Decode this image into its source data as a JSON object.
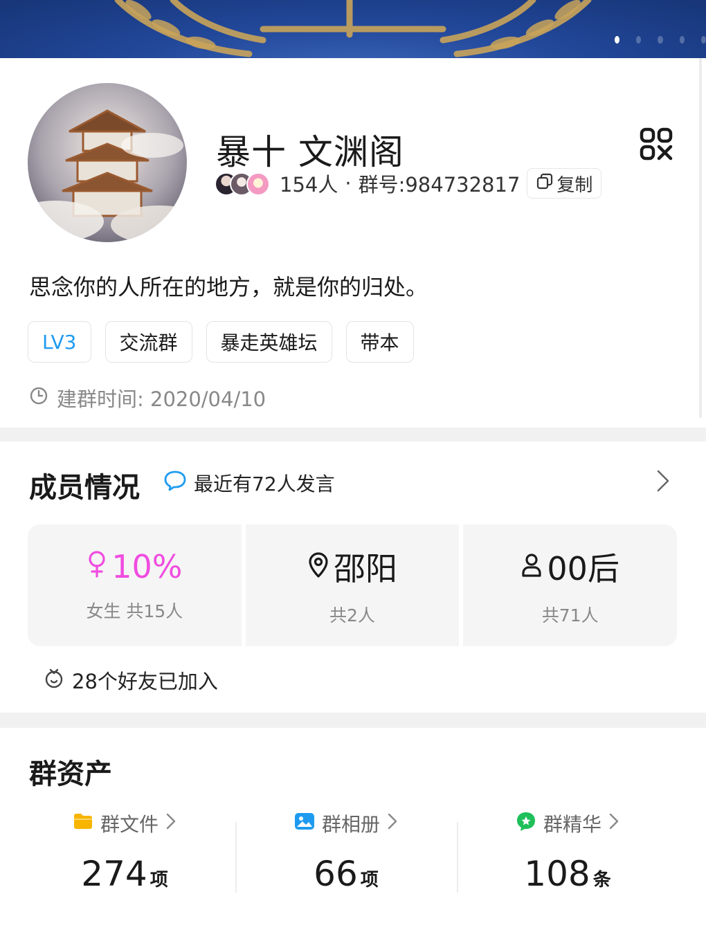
{
  "banner": {
    "slide_count": 5,
    "active_slide": 1,
    "image": "un-emblem-laurel"
  },
  "profile": {
    "group_name": "暴十 文渊阁",
    "member_count": "154人",
    "separator": "·",
    "group_id": "群号:984732817",
    "copy_label": "复制",
    "description": "思念你的人所在的地方，就是你的归处。",
    "tags": [
      "LV3",
      "交流群",
      "暴走英雄坛",
      "带本"
    ],
    "created_label": "建群时间: 2020/04/10",
    "icons": {
      "qr": "qr-code-icon",
      "copy": "copy-icon",
      "clock": "clock-icon"
    }
  },
  "members": {
    "title": "成员情况",
    "recent_text": "最近有72人发言",
    "stats": [
      {
        "main": "10%",
        "sub": "女生 共15人",
        "icon": "female-icon"
      },
      {
        "main": "邵阳",
        "sub": "共2人",
        "icon": "location-pin-icon"
      },
      {
        "main": "00后",
        "sub": "共71人",
        "icon": "person-icon"
      }
    ],
    "friends_text": "28个好友已加入"
  },
  "assets": {
    "title": "群资产",
    "items": [
      {
        "label": "群文件",
        "value": "274",
        "unit": "项",
        "icon": "folder-icon"
      },
      {
        "label": "群相册",
        "value": "66",
        "unit": "项",
        "icon": "photo-album-icon"
      },
      {
        "label": "群精华",
        "value": "108",
        "unit": "条",
        "icon": "essence-icon"
      }
    ]
  },
  "colors": {
    "accent_blue": "#1e9bf0",
    "female_pink": "#f04ce0",
    "folder_yellow": "#f7b500",
    "album_blue": "#1e9bf0",
    "essence_green": "#1fbf5a"
  }
}
